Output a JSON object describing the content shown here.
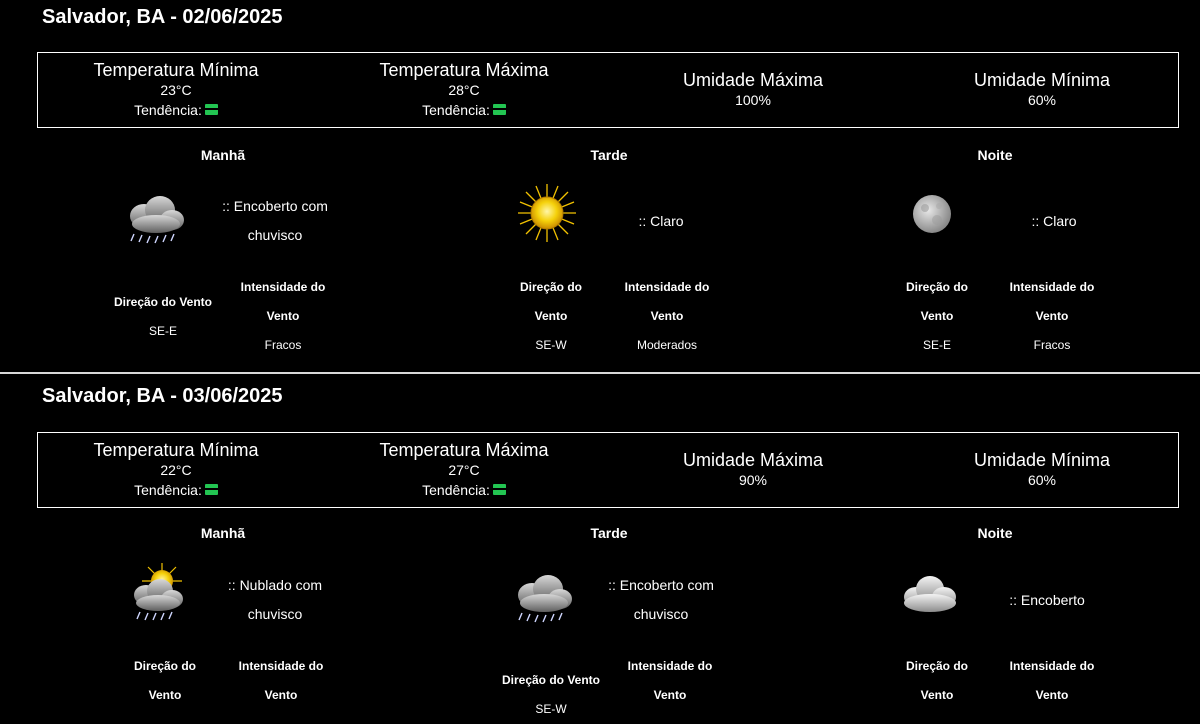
{
  "days": [
    {
      "title": "Salvador, BA - 02/06/2025",
      "temp_min": {
        "label": "Temperatura Mínima",
        "value": "23°C",
        "trend": "Tendência:"
      },
      "temp_max": {
        "label": "Temperatura Máxima",
        "value": "28°C",
        "trend": "Tendência:"
      },
      "hum_max": {
        "label": "Umidade Máxima",
        "value": "100%"
      },
      "hum_min": {
        "label": "Umidade Mínima",
        "value": "60%"
      },
      "periods": [
        {
          "name": "Manhã",
          "icon": "cloud-drizzle-icon",
          "desc1": ":: Encoberto com",
          "desc2": "chuvisco",
          "wind_dir_label": "Direção do Vento",
          "wind_dir": "SE-E",
          "wind_int_label1": "Intensidade do",
          "wind_int_label2": "Vento",
          "wind_int": "Fracos"
        },
        {
          "name": "Tarde",
          "icon": "sun-icon",
          "desc1": ":: Claro",
          "desc2": "",
          "wind_dir_label1": "Direção do",
          "wind_dir_label2": "Vento",
          "wind_dir": "SE-W",
          "wind_int_label1": "Intensidade do",
          "wind_int_label2": "Vento",
          "wind_int": "Moderados"
        },
        {
          "name": "Noite",
          "icon": "moon-icon",
          "desc1": ":: Claro",
          "desc2": "",
          "wind_dir_label1": "Direção do",
          "wind_dir_label2": "Vento",
          "wind_dir": "SE-E",
          "wind_int_label1": "Intensidade do",
          "wind_int_label2": "Vento",
          "wind_int": "Fracos"
        }
      ]
    },
    {
      "title": "Salvador, BA - 03/06/2025",
      "temp_min": {
        "label": "Temperatura Mínima",
        "value": "22°C",
        "trend": "Tendência:"
      },
      "temp_max": {
        "label": "Temperatura Máxima",
        "value": "27°C",
        "trend": "Tendência:"
      },
      "hum_max": {
        "label": "Umidade Máxima",
        "value": "90%"
      },
      "hum_min": {
        "label": "Umidade Mínima",
        "value": "60%"
      },
      "periods": [
        {
          "name": "Manhã",
          "icon": "sun-cloud-drizzle-icon",
          "desc1": ":: Nublado com",
          "desc2": "chuvisco",
          "wind_dir_label1": "Direção do",
          "wind_dir_label2": "Vento",
          "wind_int_label1": "Intensidade do",
          "wind_int_label2": "Vento"
        },
        {
          "name": "Tarde",
          "icon": "cloud-drizzle-icon",
          "desc1": ":: Encoberto com",
          "desc2": "chuvisco",
          "wind_dir_label": "Direção do Vento",
          "wind_dir": "SE-W",
          "wind_int_label1": "Intensidade do",
          "wind_int_label2": "Vento"
        },
        {
          "name": "Noite",
          "icon": "overcast-cloud-icon",
          "desc1": ":: Encoberto",
          "desc2": "",
          "wind_dir_label1": "Direção do",
          "wind_dir_label2": "Vento",
          "wind_int_label1": "Intensidade do",
          "wind_int_label2": "Vento"
        }
      ]
    }
  ]
}
